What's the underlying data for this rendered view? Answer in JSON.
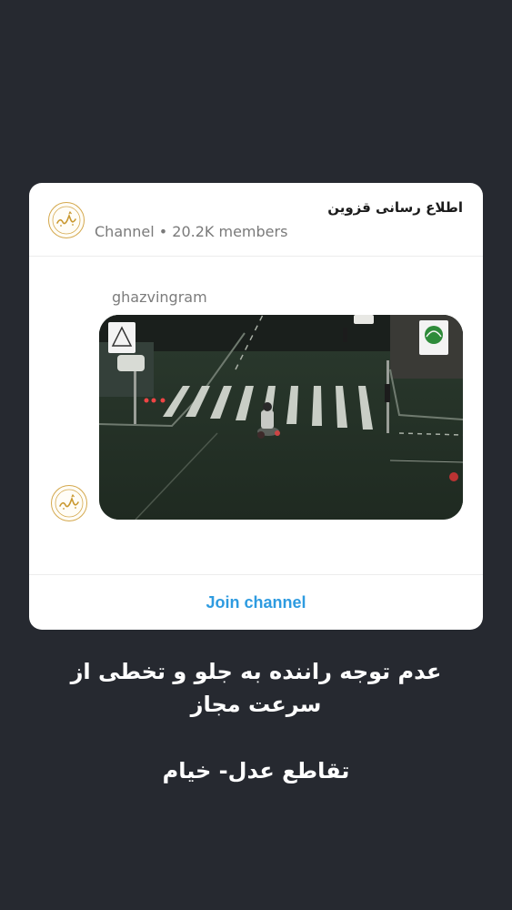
{
  "channel": {
    "title": "اطلاع رسانی قزوین",
    "meta": "Channel • 20.2K members",
    "avatar_icon": "ghazvin-aram-logo"
  },
  "post": {
    "sender": "ghazvingram",
    "media_icon": "traffic-camera-video-thumbnail"
  },
  "footer": {
    "join_label": "Join channel"
  },
  "caption": {
    "line1": "عدم توجه راننده به جلو و تخطی از",
    "line2": "سرعت مجاز",
    "line3": "تقاطع عدل- خیام"
  },
  "colors": {
    "background": "#262930",
    "card": "#ffffff",
    "accent": "#2e9be0",
    "logo": "#d4a84d"
  }
}
